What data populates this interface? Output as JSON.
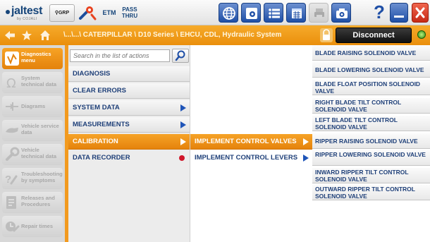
{
  "colors": {
    "accent_orange": "#f29a1f",
    "text_blue": "#1e3f78",
    "arrow_blue": "#1f55b8",
    "record_red": "#d0162a",
    "connection_green": "#2c8a12"
  },
  "toolbar": {
    "logo": "jaltest",
    "logo_sub": "by COJALI",
    "grp_label": "GRP",
    "etm_label": "ETM",
    "pass_label_1": "PASS",
    "pass_label_2": "THRU",
    "icons": [
      "search-icon",
      "tool-icon",
      "etm-icon",
      "pass-thru-icon",
      "globe-icon",
      "eye-icon",
      "list-icon",
      "calendar-icon",
      "print-icon",
      "camera-icon",
      "help-icon",
      "minimize-icon",
      "maximize-icon",
      "close-icon"
    ]
  },
  "breadcrumb": {
    "path": "\\...\\...\\ CATERPILLAR \\ D10 Series \\ EHCU, CDL, Hydraulic System",
    "disconnect_label": "Disconnect"
  },
  "sidebar": {
    "items": [
      {
        "label": "Diagnostics menu",
        "icon": "diagnostics-icon",
        "active": true
      },
      {
        "label": "System technical data",
        "icon": "omega-icon",
        "active": false
      },
      {
        "label": "Diagrams",
        "icon": "diagram-icon",
        "active": false
      },
      {
        "label": "Vehicle service data",
        "icon": "service-icon",
        "active": false
      },
      {
        "label": "Vehicle technical data",
        "icon": "wrench-icon",
        "active": false
      },
      {
        "label": "Troubleshooting by symptoms",
        "icon": "troubleshooting-icon",
        "active": false
      },
      {
        "label": "Releases and Procedures",
        "icon": "procedures-icon",
        "active": false
      },
      {
        "label": "Repair times",
        "icon": "repair-time-icon",
        "active": false
      }
    ]
  },
  "search": {
    "placeholder": "Search in the list of actions"
  },
  "actions": [
    {
      "label": "DIAGNOSIS",
      "marker": "none",
      "active": false
    },
    {
      "label": "CLEAR ERRORS",
      "marker": "none",
      "active": false
    },
    {
      "label": "SYSTEM DATA",
      "marker": "arrow",
      "active": false
    },
    {
      "label": "MEASUREMENTS",
      "marker": "arrow",
      "active": false
    },
    {
      "label": "CALIBRATION",
      "marker": "arrow",
      "active": true
    },
    {
      "label": "DATA RECORDER",
      "marker": "dot",
      "active": false
    }
  ],
  "subactions": [
    {
      "label": "IMPLEMENT CONTROL VALVES",
      "marker": "arrow",
      "active": true
    },
    {
      "label": "IMPLEMENT CONTROL LEVERS",
      "marker": "arrow",
      "active": false
    }
  ],
  "values": [
    "BLADE RAISING SOLENOID VALVE",
    "BLADE LOWERING SOLENOID VALVE",
    "BLADE FLOAT POSITION SOLENOID VALVE",
    "RIGHT BLADE TILT CONTROL SOLENOID VALVE",
    "LEFT BLADE TILT CONTROL SOLENOID VALVE",
    "RIPPER RAISING SOLENOID VALVE",
    "RIPPER LOWERING SOLENOID VALVE",
    "INWARD RIPPER TILT CONTROL SOLENOID VALVE",
    "OUTWARD RIPPER TILT CONTROL SOLENOID VALVE"
  ]
}
